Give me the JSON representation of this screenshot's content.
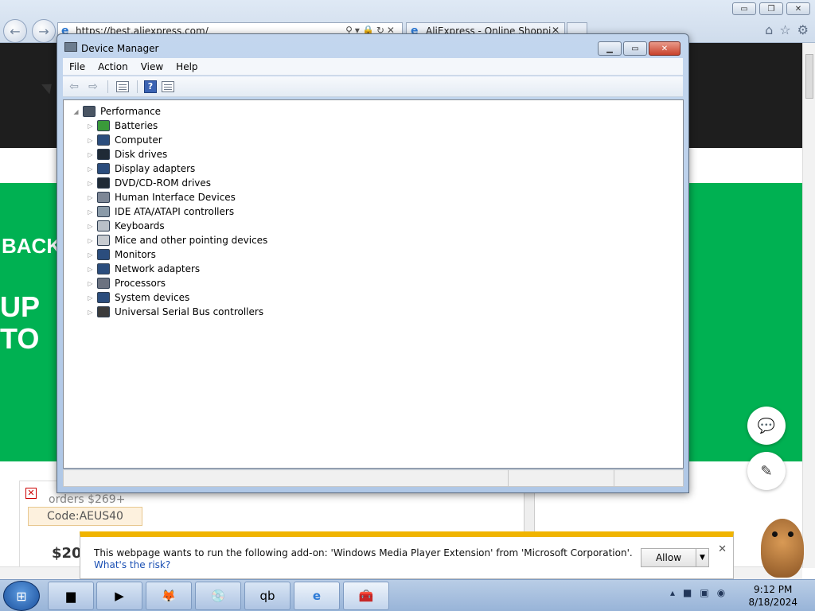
{
  "browser": {
    "address": "https://best.aliexpress.com/",
    "tab_title": "AliExpress - Online Shoppi...",
    "window_controls": {
      "min": "▭",
      "max": "❐",
      "close": "✕"
    },
    "icons": [
      "home-icon",
      "favorites-icon",
      "settings-icon"
    ]
  },
  "webpage": {
    "banner_text1": "BACK",
    "banner_text2_line1": "UP",
    "banner_text2_line2": "TO",
    "coupon": {
      "orders_text": "orders $269+",
      "code_text": "Code:AEUS40",
      "price_text": "$20"
    }
  },
  "device_manager": {
    "title": "Device Manager",
    "menu": [
      "File",
      "Action",
      "View",
      "Help"
    ],
    "root": "Performance",
    "items": [
      {
        "label": "Batteries",
        "color": "#3a9a3a"
      },
      {
        "label": "Computer",
        "color": "#2b4d7d"
      },
      {
        "label": "Disk drives",
        "color": "#1f2a36"
      },
      {
        "label": "Display adapters",
        "color": "#2b4d7d"
      },
      {
        "label": "DVD/CD-ROM drives",
        "color": "#1f2a36"
      },
      {
        "label": "Human Interface Devices",
        "color": "#7d8796"
      },
      {
        "label": "IDE ATA/ATAPI controllers",
        "color": "#8a9aa8"
      },
      {
        "label": "Keyboards",
        "color": "#b9c0c8"
      },
      {
        "label": "Mice and other pointing devices",
        "color": "#c8ccd1"
      },
      {
        "label": "Monitors",
        "color": "#2b4d7d"
      },
      {
        "label": "Network adapters",
        "color": "#2b4d7d"
      },
      {
        "label": "Processors",
        "color": "#6b7280"
      },
      {
        "label": "System devices",
        "color": "#2b4d7d"
      },
      {
        "label": "Universal Serial Bus controllers",
        "color": "#3b3b3b"
      }
    ]
  },
  "notification": {
    "message": "This webpage wants to run the following add-on: 'Windows Media Player Extension' from 'Microsoft Corporation'.",
    "link": "What's the risk?",
    "allow_label": "Allow"
  },
  "taskbar": {
    "time": "9:12 PM",
    "date": "8/18/2024"
  }
}
